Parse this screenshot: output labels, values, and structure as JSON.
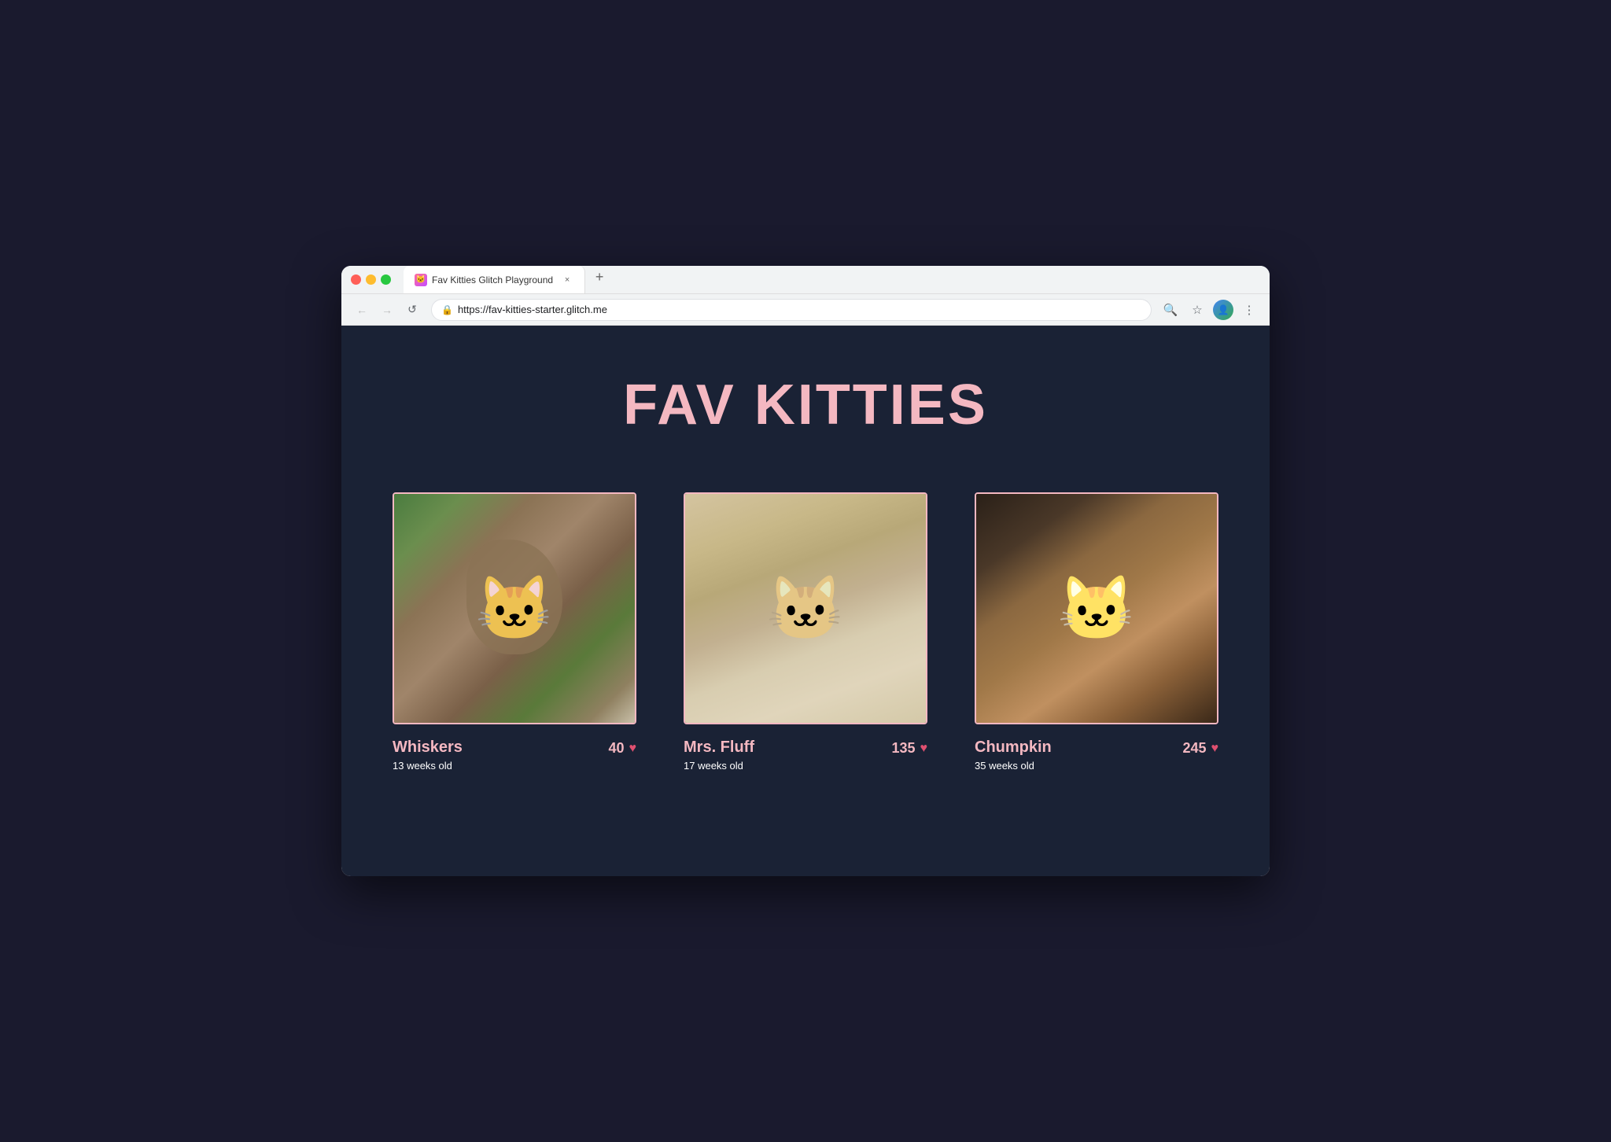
{
  "browser": {
    "tab_title": "Fav Kitties Glitch Playground",
    "tab_close_label": "×",
    "new_tab_label": "+",
    "url": "https://fav-kitties-starter.glitch.me",
    "back_label": "←",
    "forward_label": "→",
    "reload_label": "↺",
    "search_icon_label": "🔍",
    "star_icon_label": "☆",
    "more_icon_label": "⋮",
    "lock_label": "🔒"
  },
  "page": {
    "title": "FAV KITTIES",
    "cats": [
      {
        "id": "whiskers",
        "name": "Whiskers",
        "age": "13 weeks old",
        "likes": "40",
        "image_style": "cat-img-whiskers"
      },
      {
        "id": "mrsfluff",
        "name": "Mrs. Fluff",
        "age": "17 weeks old",
        "likes": "135",
        "image_style": "cat-img-mrsfluff"
      },
      {
        "id": "chumpkin",
        "name": "Chumpkin",
        "age": "35 weeks old",
        "likes": "245",
        "image_style": "cat-img-chumpkin"
      }
    ]
  }
}
